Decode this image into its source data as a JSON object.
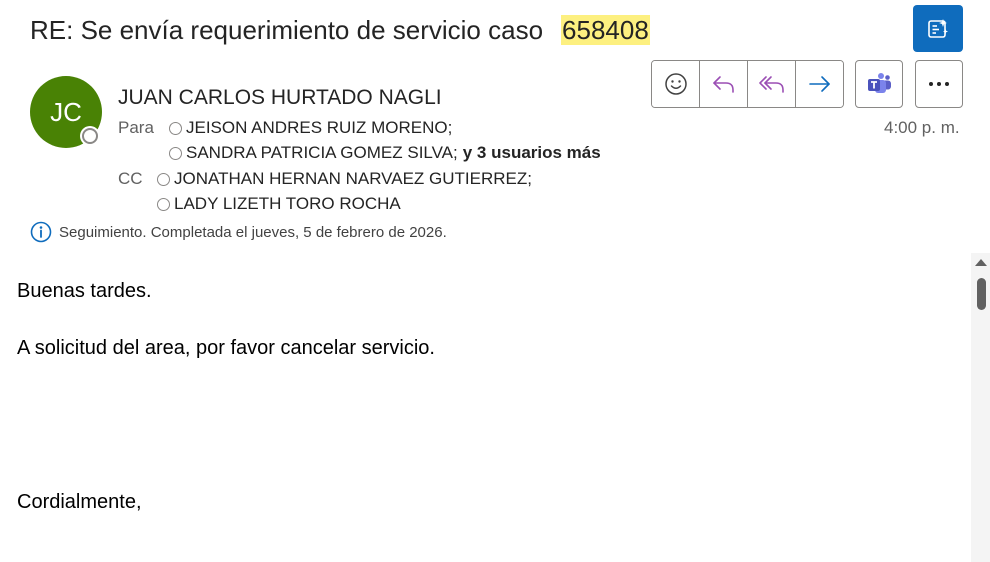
{
  "subject": {
    "text": "RE: Se envía requerimiento de servicio caso",
    "case_number": "658408"
  },
  "sender": {
    "initials": "JC",
    "name": "JUAN CARLOS HURTADO NAGLI"
  },
  "recipients": {
    "to_label": "Para",
    "to": [
      "JEISON ANDRES RUIZ MORENO;",
      "SANDRA PATRICIA GOMEZ SILVA;"
    ],
    "more": "y 3 usuarios más",
    "cc_label": "CC",
    "cc": [
      "JONATHAN HERNAN NARVAEZ GUTIERREZ;",
      "LADY LIZETH TORO ROCHA"
    ]
  },
  "time": "4:00 p. m.",
  "followup": "Seguimiento.  Completada el jueves, 5 de febrero de 2026.",
  "body": {
    "greeting": "Buenas tardes.",
    "message": "A solicitud del area, por favor cancelar servicio.",
    "closing": "Cordialmente,"
  },
  "icons": {
    "copilot": "copilot-summary-icon",
    "emoji": "emoji-icon",
    "reply": "reply-icon",
    "reply_all": "reply-all-icon",
    "forward": "forward-icon",
    "teams": "teams-icon",
    "more": "more-icon",
    "info": "info-icon"
  },
  "colors": {
    "accent": "#0f6cbd",
    "avatar": "#498205",
    "highlight": "#fdf080",
    "reply": "#9b4fb4",
    "forward": "#0f6cbd",
    "teams": "#5b5fc7"
  }
}
